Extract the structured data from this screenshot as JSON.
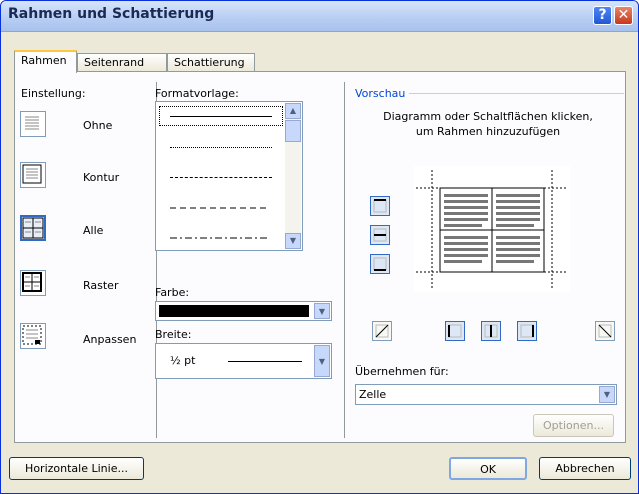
{
  "window": {
    "title": "Rahmen und Schattierung",
    "help_glyph": "?",
    "close_glyph": "✕"
  },
  "tabs": [
    {
      "label": "Rahmen",
      "active": true
    },
    {
      "label": "Seitenrand",
      "active": false
    },
    {
      "label": "Schattierung",
      "active": false
    }
  ],
  "einstellung": {
    "label": "Einstellung:",
    "items": [
      {
        "label": "Ohne",
        "selected": false
      },
      {
        "label": "Kontur",
        "selected": false
      },
      {
        "label": "Alle",
        "selected": true
      },
      {
        "label": "Raster",
        "selected": false
      },
      {
        "label": "Anpassen",
        "selected": false
      }
    ]
  },
  "formatvorlage": {
    "label": "Formatvorlage:",
    "styles": [
      "solid",
      "dotted",
      "dashed",
      "long-dashed",
      "dash-dot"
    ],
    "selected": "solid"
  },
  "farbe": {
    "label": "Farbe:",
    "value_color": "#000000"
  },
  "breite": {
    "label": "Breite:",
    "value": "½ pt"
  },
  "vorschau": {
    "label": "Vorschau",
    "hint": "Diagramm oder Schaltflächen klicken, um Rahmen hinzuzufügen",
    "uebernehmen_label": "Übernehmen für:",
    "uebernehmen_value": "Zelle",
    "options_button": "Optionen..."
  },
  "footer": {
    "horizontal_line": "Horizontale Linie...",
    "ok": "OK",
    "cancel": "Abbrechen"
  }
}
